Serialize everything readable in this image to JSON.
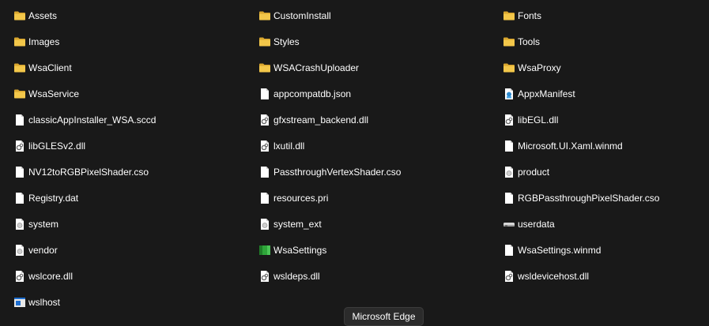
{
  "files": [
    {
      "name": "Assets",
      "icon": "folder-icon"
    },
    {
      "name": "CustomInstall",
      "icon": "folder-icon"
    },
    {
      "name": "Fonts",
      "icon": "folder-icon"
    },
    {
      "name": "Images",
      "icon": "folder-icon"
    },
    {
      "name": "Styles",
      "icon": "folder-icon"
    },
    {
      "name": "Tools",
      "icon": "folder-icon"
    },
    {
      "name": "WsaClient",
      "icon": "folder-icon"
    },
    {
      "name": "WSACrashUploader",
      "icon": "folder-icon"
    },
    {
      "name": "WsaProxy",
      "icon": "folder-icon"
    },
    {
      "name": "WsaService",
      "icon": "folder-icon"
    },
    {
      "name": "appcompatdb.json",
      "icon": "document-icon"
    },
    {
      "name": "AppxManifest",
      "icon": "manifest-icon"
    },
    {
      "name": "classicAppInstaller_WSA.sccd",
      "icon": "document-icon"
    },
    {
      "name": "gfxstream_backend.dll",
      "icon": "dll-icon"
    },
    {
      "name": "libEGL.dll",
      "icon": "dll-icon"
    },
    {
      "name": "libGLESv2.dll",
      "icon": "dll-icon"
    },
    {
      "name": "lxutil.dll",
      "icon": "dll-icon"
    },
    {
      "name": "Microsoft.UI.Xaml.winmd",
      "icon": "document-icon"
    },
    {
      "name": "NV12toRGBPixelShader.cso",
      "icon": "document-icon"
    },
    {
      "name": "PassthroughVertexShader.cso",
      "icon": "document-icon"
    },
    {
      "name": "product",
      "icon": "generic-file-icon"
    },
    {
      "name": "Registry.dat",
      "icon": "document-icon"
    },
    {
      "name": "resources.pri",
      "icon": "document-icon"
    },
    {
      "name": "RGBPassthroughPixelShader.cso",
      "icon": "document-icon"
    },
    {
      "name": "system",
      "icon": "generic-file-icon"
    },
    {
      "name": "system_ext",
      "icon": "generic-file-icon"
    },
    {
      "name": "userdata",
      "icon": "drive-icon"
    },
    {
      "name": "vendor",
      "icon": "generic-file-icon"
    },
    {
      "name": "WsaSettings",
      "icon": "wsa-app-icon"
    },
    {
      "name": "WsaSettings.winmd",
      "icon": "document-icon"
    },
    {
      "name": "wslcore.dll",
      "icon": "dll-icon"
    },
    {
      "name": "wsldeps.dll",
      "icon": "dll-icon"
    },
    {
      "name": "wsldevicehost.dll",
      "icon": "dll-icon"
    },
    {
      "name": "wslhost",
      "icon": "application-icon"
    }
  ],
  "tooltip": {
    "text": "Microsoft Edge"
  },
  "colors": {
    "background": "#191919",
    "folder": "#f3c74a",
    "folder_dark": "#d9a62e",
    "document": "#ffffff",
    "tooltip_bg": "#2b2b2b",
    "wsa_green": "#2fa63a",
    "wslhost_blue": "#1f6fd1"
  }
}
